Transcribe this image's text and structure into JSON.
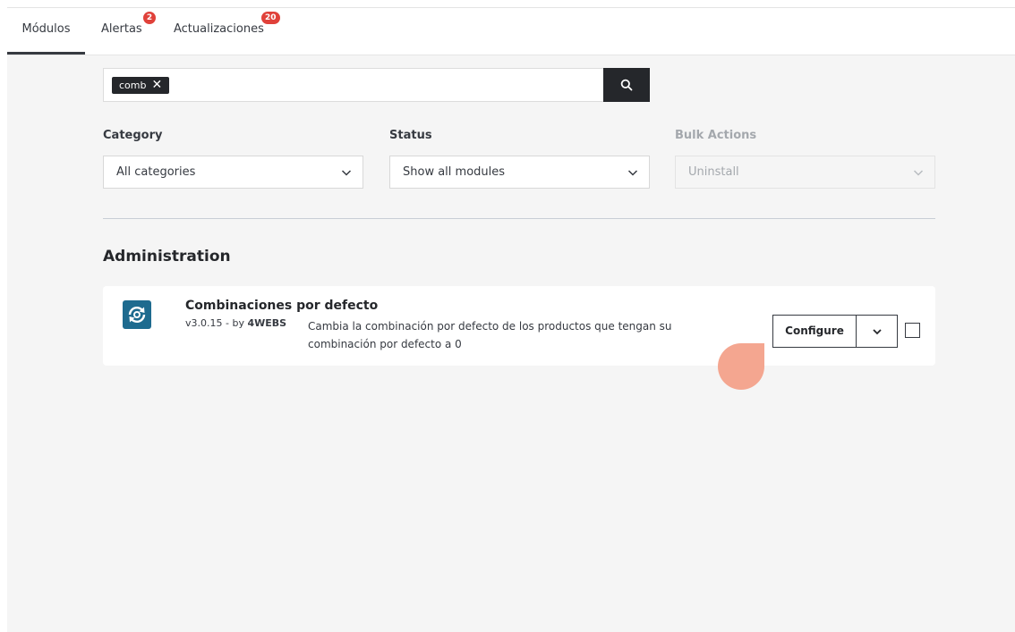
{
  "tabs": [
    {
      "label": "Módulos",
      "active": true
    },
    {
      "label": "Alertas",
      "badge": "2"
    },
    {
      "label": "Actualizaciones",
      "badge": "20"
    }
  ],
  "search": {
    "chip_text": "comb",
    "chip_close_icon": "close-icon",
    "button_icon": "search-icon"
  },
  "filters": {
    "category": {
      "label": "Category",
      "value": "All categories"
    },
    "status": {
      "label": "Status",
      "value": "Show all modules"
    },
    "bulk": {
      "label": "Bulk Actions",
      "value": "Uninstall",
      "disabled": true
    }
  },
  "section": {
    "title": "Administration"
  },
  "module": {
    "name": "Combinaciones por defecto",
    "version": "v3.0.15 - by ",
    "author": "4WEBS",
    "description": "Cambia la combinación por defecto de los productos que tengan su combinación por defecto a 0",
    "configure_label": "Configure",
    "dropdown_icon": "chevron-down-icon",
    "logo_icon": "refresh-icon"
  },
  "colors": {
    "accent_dark": "#25272b",
    "badge": "#e0413a",
    "logo_bg": "#1e6b8f",
    "touch_marker": "#f4a690"
  }
}
